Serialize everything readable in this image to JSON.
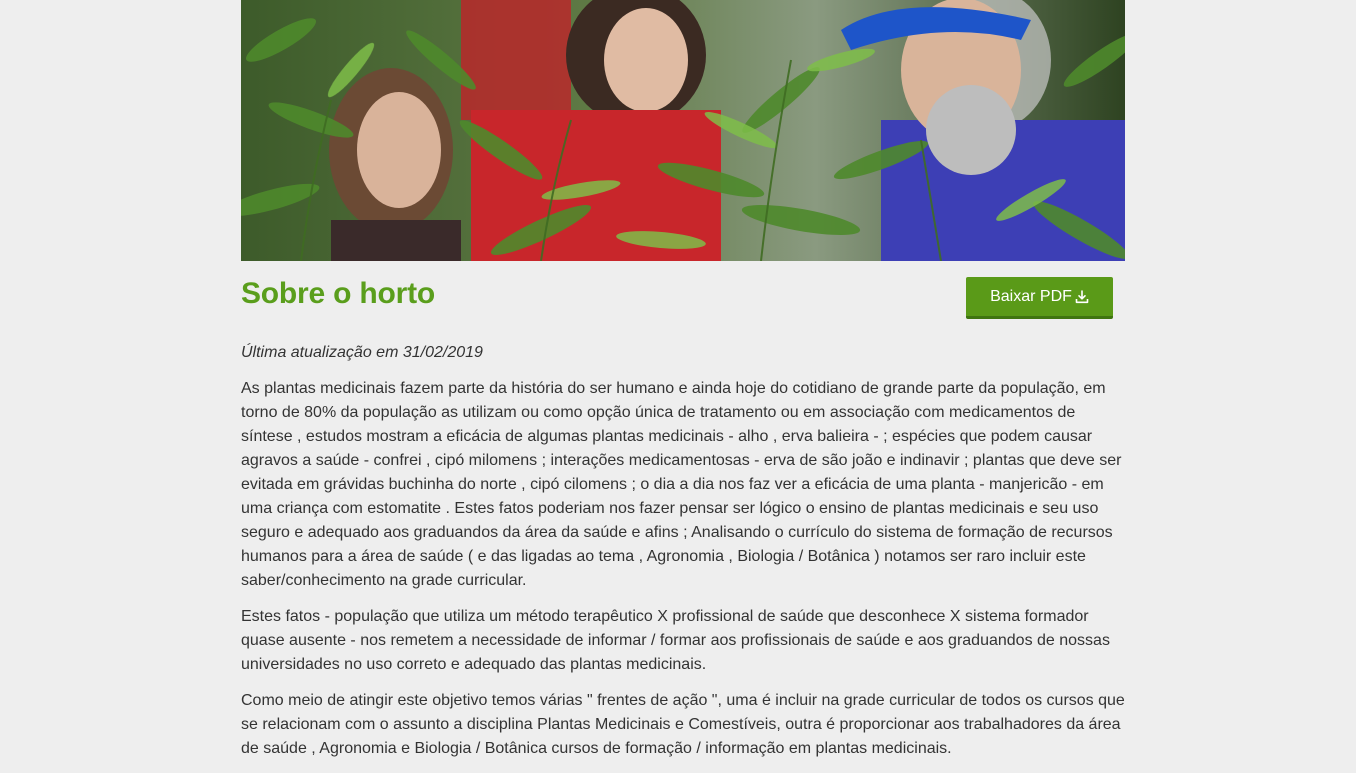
{
  "hero": {
    "image_alt": "people-among-medicinal-plants"
  },
  "header": {
    "title": "Sobre o horto",
    "download_button_label": "Baixar PDF",
    "download_icon": "download-icon"
  },
  "article": {
    "last_updated": "Última atualização em 31/02/2019",
    "paragraphs": [
      "As plantas medicinais fazem parte da história do ser humano e ainda hoje do cotidiano de grande parte da população, em torno de 80% da população as utilizam ou como opção única de tratamento ou em associação com medicamentos de síntese , estudos mostram a eficácia de algumas plantas medicinais - alho , erva balieira - ; espécies que podem causar agravos a saúde - confrei , cipó milomens ; interações medicamentosas - erva de são joão e indinavir ; plantas que deve ser evitada em grávidas buchinha do norte , cipó cilomens ; o dia a dia nos faz ver a eficácia de uma planta - manjericão - em uma criança com estomatite . Estes fatos poderiam nos fazer pensar ser lógico o ensino de plantas medicinais e seu uso seguro e adequado aos graduandos da área da saúde e afins ; Analisando o currículo do sistema de formação de recursos humanos para a área de saúde ( e das ligadas ao tema , Agronomia , Biologia / Botânica ) notamos ser raro incluir este saber/conhecimento na grade curricular.",
      "Estes fatos - população que utiliza um método terapêutico X profissional de saúde que desconhece X sistema formador quase ausente - nos remetem a necessidade de informar / formar aos profissionais de saúde e aos graduandos de nossas universidades no uso correto e adequado das plantas medicinais.",
      "Como meio de atingir este objetivo temos várias \" frentes de ação \", uma é incluir na grade curricular de todos os cursos que se relacionam com o assunto a disciplina Plantas Medicinais e Comestíveis, outra é proporcionar aos trabalhadores da área de saúde , Agronomia e Biologia / Botânica cursos de formação / informação em plantas medicinais."
    ]
  },
  "colors": {
    "accent": "#5a9e1c",
    "button": "#5a9a18",
    "background": "#eeeeee",
    "text": "#333333"
  }
}
